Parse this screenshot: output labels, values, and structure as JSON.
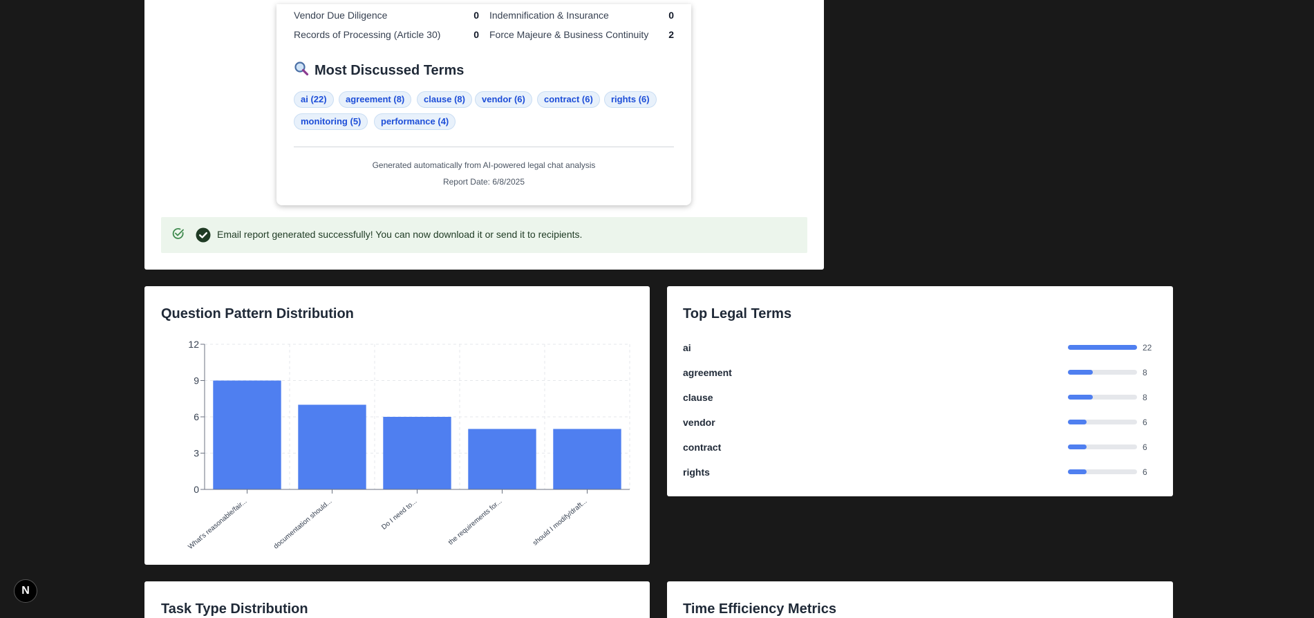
{
  "report": {
    "category_rows": [
      {
        "left_label": "Vendor Due Diligence",
        "left_value": "0",
        "right_label": "Indemnification & Insurance",
        "right_value": "0"
      },
      {
        "left_label": "Records of Processing (Article 30)",
        "left_value": "0",
        "right_label": "Force Majeure & Business Continuity",
        "right_value": "2"
      }
    ],
    "terms_heading": "Most Discussed Terms",
    "term_chips": [
      "ai (22)",
      "agreement (8)",
      "clause (8)",
      "vendor (6)",
      "contract (6)",
      "rights (6)",
      "monitoring (5)",
      "performance (4)"
    ],
    "footer_generated": "Generated automatically from AI-powered legal chat analysis",
    "footer_date": "Report Date: 6/8/2025"
  },
  "success_message": "Email report generated successfully! You can now download it or send it to recipients.",
  "question_chart": {
    "title": "Question Pattern Distribution"
  },
  "chart_data": {
    "type": "bar",
    "title": "Question Pattern Distribution",
    "categories": [
      "What's reasonable/fair...",
      "documentation should...",
      "Do I need to...",
      "the requirements for...",
      "should I modify/draft..."
    ],
    "values": [
      9,
      7,
      6,
      5,
      5
    ],
    "yticks": [
      "0",
      "3",
      "6",
      "9",
      "12"
    ],
    "ylim": [
      0,
      12
    ],
    "grid": true,
    "color": "#4f7ff0"
  },
  "top_terms": {
    "title": "Top Legal Terms",
    "max": 22,
    "items": [
      {
        "label": "ai",
        "count": "22",
        "value": 22
      },
      {
        "label": "agreement",
        "count": "8",
        "value": 8
      },
      {
        "label": "clause",
        "count": "8",
        "value": 8
      },
      {
        "label": "vendor",
        "count": "6",
        "value": 6
      },
      {
        "label": "contract",
        "count": "6",
        "value": 6
      },
      {
        "label": "rights",
        "count": "6",
        "value": 6
      }
    ]
  },
  "task_card": {
    "title": "Task Type Distribution"
  },
  "time_card": {
    "title": "Time Efficiency Metrics"
  },
  "dev_badge": {
    "letter": "N"
  },
  "colors": {
    "accent": "#4f7ff0",
    "success_bg": "#ecf5ec",
    "chip_bg": "#e8f1fb",
    "chip_text": "#1d4ed8"
  }
}
